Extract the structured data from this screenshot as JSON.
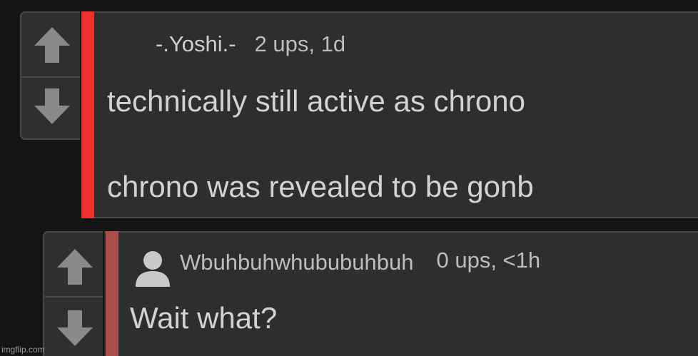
{
  "colors": {
    "background": "#141414",
    "panel": "#2e2e2e",
    "accent_red": "#f0302e",
    "accent_muted_red": "#a84f4c",
    "text": "#d2d2d2",
    "meta_text": "#bdbdbd",
    "arrow": "#8a8a8a"
  },
  "comments": [
    {
      "author": "-.Yoshi.-",
      "stats": "2 ups, 1d",
      "lines": [
        "technically still active as chrono",
        "chrono was revealed to be gonb"
      ],
      "icons": {
        "upvote": "arrow-up-icon",
        "downvote": "arrow-down-icon"
      }
    },
    {
      "author": "Wbuhbuhwhububuhbuh",
      "stats": "0 ups, <1h",
      "lines": [
        "Wait what?"
      ],
      "icons": {
        "avatar": "user-silhouette-icon",
        "upvote": "arrow-up-icon",
        "downvote": "arrow-down-icon"
      }
    }
  ],
  "watermark": "imgflip.com"
}
